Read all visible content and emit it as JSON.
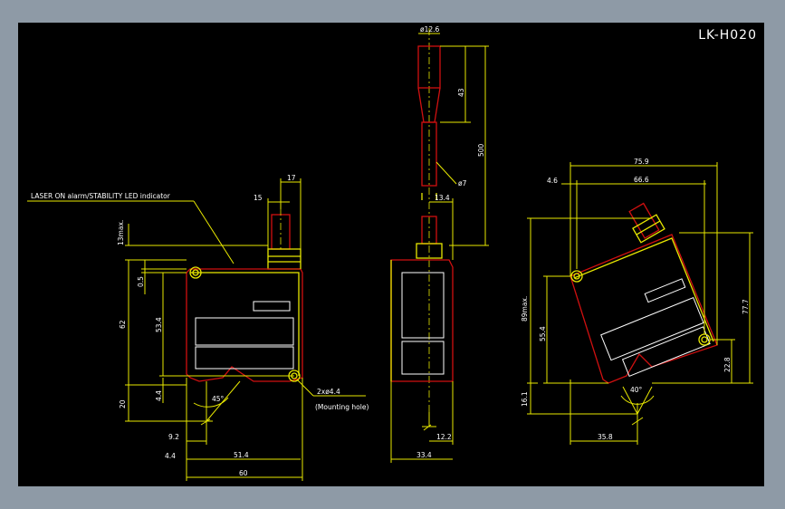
{
  "drawing": {
    "title": "LK-H020",
    "annotations": {
      "laser_indicator": "LASER ON alarm/STABILITY LED indicator",
      "mounting_hole_size": "2xø4.4",
      "mounting_hole_label": "(Mounting hole)"
    },
    "front_view": {
      "dim_17": "17",
      "dim_15": "15",
      "dim_13max": "13max.",
      "dim_0_5": "0.5",
      "dim_62": "62",
      "dim_53_4": "53.4",
      "dim_20": "20",
      "dim_4_4_v": "4.4",
      "dim_9_2": "9.2",
      "dim_4_4_h": "4.4",
      "dim_51_4": "51.4",
      "dim_60": "60",
      "angle_45": "45°"
    },
    "side_view": {
      "dim_dia_12_6": "ø12.6",
      "dim_43": "43",
      "dim_500": "500",
      "dim_dia_7": "ø7",
      "dim_13_4": "13.4",
      "dim_12_2": "12.2",
      "dim_33_4": "33.4"
    },
    "rotated_view": {
      "dim_75_9": "75.9",
      "dim_4_6": "4.6",
      "dim_66_6": "66.6",
      "dim_89max": "89max.",
      "dim_55_4": "55.4",
      "dim_77_7": "77.7",
      "dim_22_8": "22.8",
      "dim_16_1": "16.1",
      "dim_35_8": "35.8",
      "angle_40": "40°"
    }
  }
}
